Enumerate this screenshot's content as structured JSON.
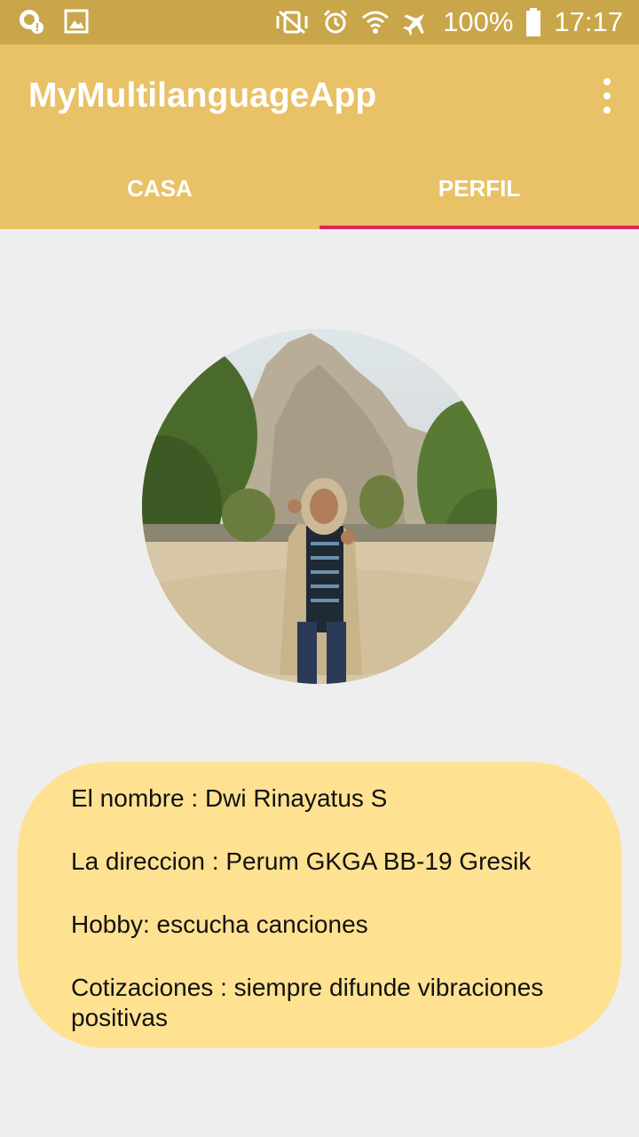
{
  "status_bar": {
    "battery": "100%",
    "time": "17:17",
    "icons": [
      "notification-icon",
      "gallery-icon",
      "vibrate-icon",
      "alarm-icon",
      "wifi-icon",
      "airplane-icon",
      "battery-icon"
    ]
  },
  "app_bar": {
    "title": "MyMultilanguageApp",
    "overflow_icon": "more-vert-icon"
  },
  "tabs": [
    {
      "label": "CASA",
      "active": false
    },
    {
      "label": "PERFIL",
      "active": true
    }
  ],
  "colors": {
    "status_bar": "#c9a64a",
    "app_bar": "#e9c166",
    "tab_indicator": "#e0245e",
    "card": "#fee292",
    "background": "#eeeeee"
  },
  "profile": {
    "name_line": "El nombre : Dwi Rinayatus S",
    "address_line": "La direccion : Perum GKGA BB-19 Gresik",
    "hobby_line": "Hobby: escucha canciones",
    "quote_line": "Cotizaciones : siempre difunde vibraciones positivas"
  }
}
